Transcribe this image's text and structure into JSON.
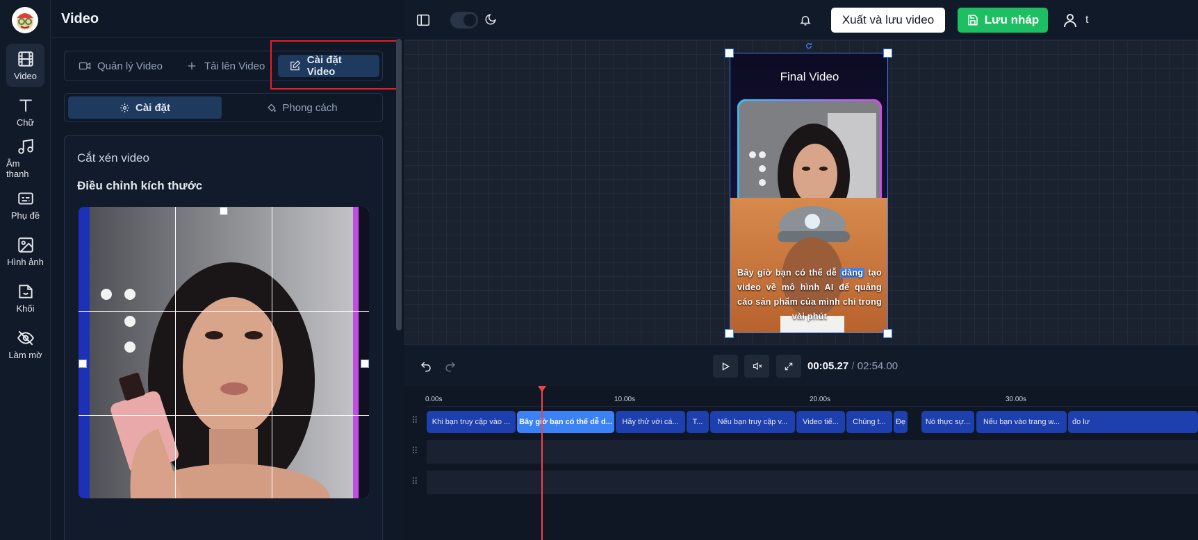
{
  "rail": {
    "items": [
      {
        "label": "Video",
        "icon": "film-icon"
      },
      {
        "label": "Chữ",
        "icon": "text-icon"
      },
      {
        "label": "Âm thanh",
        "icon": "music-icon"
      },
      {
        "label": "Phụ đề",
        "icon": "subtitle-icon"
      },
      {
        "label": "Hình ảnh",
        "icon": "image-icon"
      },
      {
        "label": "Khối",
        "icon": "sticker-icon"
      },
      {
        "label": "Làm mờ",
        "icon": "eye-off-icon"
      }
    ]
  },
  "panel": {
    "title": "Video",
    "tabs": [
      {
        "label": "Quản lý Video",
        "icon": "video-camera-icon"
      },
      {
        "label": "Tải lên Video",
        "icon": "plus-icon"
      },
      {
        "label": "Cài đặt Video",
        "icon": "edit-icon"
      }
    ],
    "subtabs": [
      {
        "label": "Cài đặt",
        "icon": "gear-icon"
      },
      {
        "label": "Phong cách",
        "icon": "paint-bucket-icon"
      }
    ],
    "card_title": "Cắt xén video",
    "card_subtitle": "Điều chỉnh kích thước"
  },
  "topbar": {
    "export_label": "Xuất và lưu video",
    "save_draft_label": "Lưu nháp",
    "user_initial": "t"
  },
  "preview": {
    "title": "Final Video",
    "subtitle_before": "Bây giờ bạn có thể dễ ",
    "subtitle_highlight": "dàng",
    "subtitle_after": " tạo video về mô hình AI để quảng cáo sản phẩm của mình chỉ trong vài phút"
  },
  "player": {
    "current_time": "00:05.27",
    "separator": "/",
    "total_time": "02:54.00"
  },
  "timeline": {
    "ticks": [
      "0.00s",
      "10.00s",
      "20.00s",
      "30.00s"
    ],
    "clips": [
      {
        "label": "Khi bạn truy cập vào ..."
      },
      {
        "label": "Bây giờ bạn có thể dễ d..."
      },
      {
        "label": "Hãy thử với cá..."
      },
      {
        "label": "T..."
      },
      {
        "label": "Nếu bạn truy cập v..."
      },
      {
        "label": "Video tiế..."
      },
      {
        "label": "Chúng t..."
      },
      {
        "label": "Đẹ"
      },
      {
        "label": "Nó thực sự..."
      },
      {
        "label": "Nếu bạn vào trang w..."
      },
      {
        "label": "đo lư"
      }
    ]
  },
  "colors": {
    "accent": "#3b82f6",
    "save_green": "#1dbf62",
    "highlight_red": "#ef1c24",
    "playhead": "#ef4444"
  }
}
